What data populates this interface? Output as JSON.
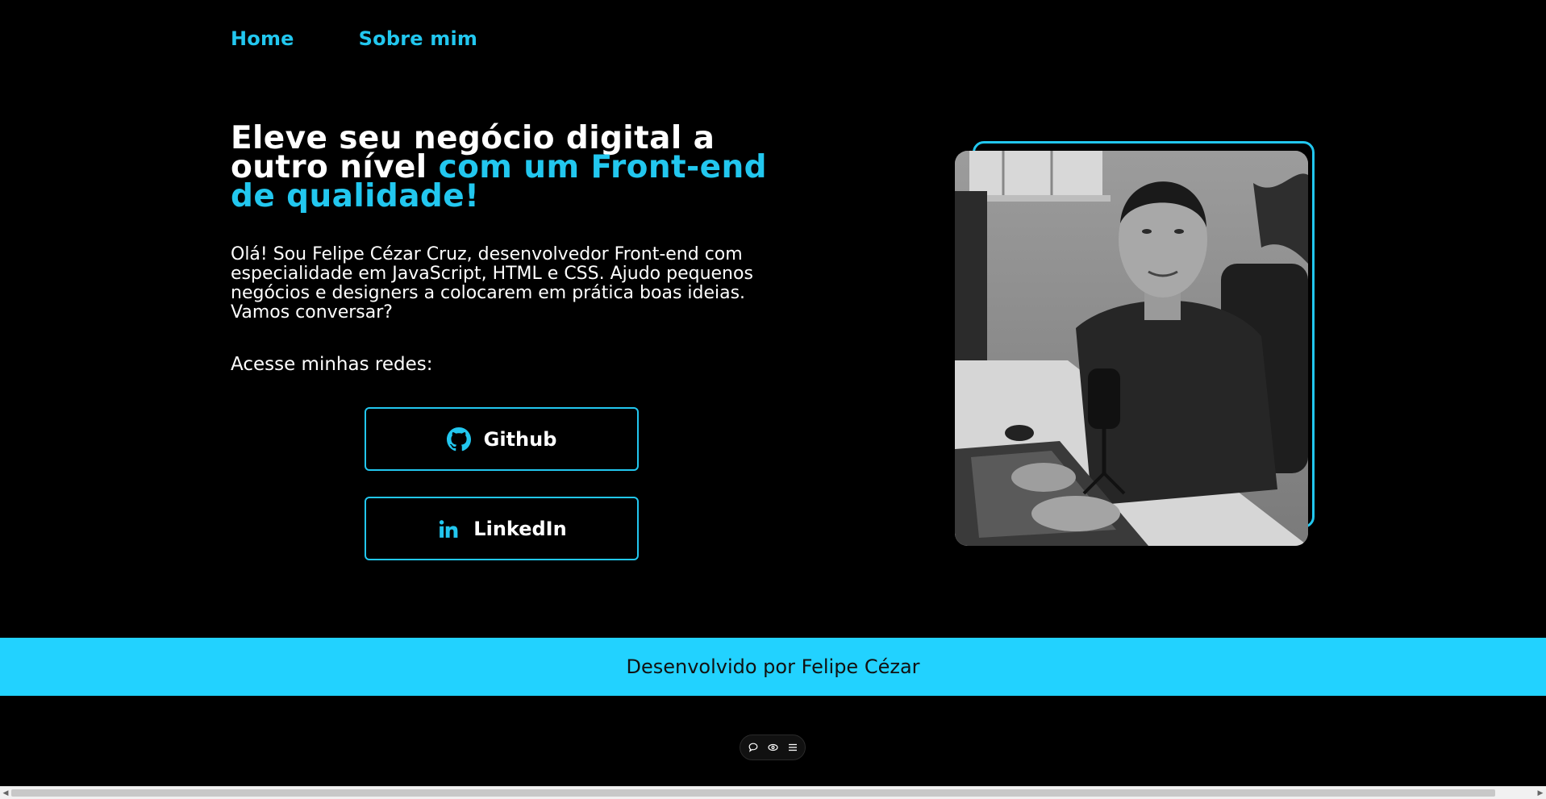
{
  "nav": {
    "items": [
      {
        "label": "Home"
      },
      {
        "label": "Sobre mim"
      }
    ]
  },
  "hero": {
    "title_part1": "Eleve seu negócio digital a outro nível ",
    "title_accent": "com um Front-end de qualidade!",
    "intro": "Olá! Sou Felipe Cézar Cruz, desenvolvedor Front-end com especialidade em JavaScript, HTML e CSS. Ajudo pequenos negócios e designers a colocarem em prática boas ideias. Vamos conversar?",
    "socials_label": "Acesse minhas redes:"
  },
  "socials": {
    "github": {
      "label": "Github",
      "icon": "github-icon"
    },
    "linkedin": {
      "label": "LinkedIn",
      "icon": "linkedin-icon"
    }
  },
  "photo": {
    "description_icon": "profile-photo"
  },
  "footer": {
    "text": "Desenvolvido por Felipe Cézar"
  },
  "toolbar": {
    "icons": [
      "comment-icon",
      "eye-icon",
      "menu-icon"
    ]
  },
  "colors": {
    "accent": "#22c7ef",
    "footer_bg": "#22d2ff",
    "background": "#000000"
  }
}
